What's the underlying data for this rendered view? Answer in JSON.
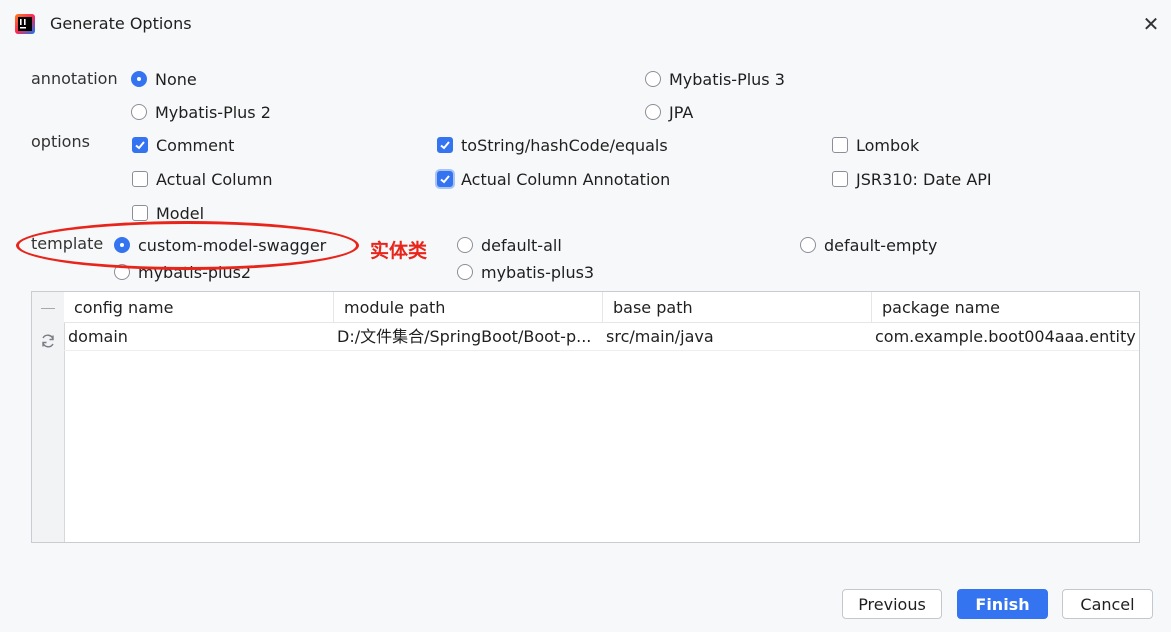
{
  "window": {
    "title": "Generate Options",
    "close_glyph": "✕"
  },
  "annotation": {
    "label": "annotation",
    "options": [
      {
        "label": "None",
        "selected": true
      },
      {
        "label": "Mybatis-Plus 3",
        "selected": false
      },
      {
        "label": "Mybatis-Plus 2",
        "selected": false
      },
      {
        "label": "JPA",
        "selected": false
      }
    ]
  },
  "options": {
    "label": "options",
    "items": [
      {
        "label": "Comment",
        "checked": true
      },
      {
        "label": "toString/hashCode/equals",
        "checked": true
      },
      {
        "label": "Lombok",
        "checked": false
      },
      {
        "label": "Actual Column",
        "checked": false
      },
      {
        "label": "Actual Column Annotation",
        "checked": true
      },
      {
        "label": "JSR310: Date API",
        "checked": false
      },
      {
        "label": "Model",
        "checked": false
      }
    ]
  },
  "template": {
    "label": "template",
    "options": [
      {
        "label": "custom-model-swagger",
        "selected": true
      },
      {
        "label": "default-all",
        "selected": false
      },
      {
        "label": "default-empty",
        "selected": false
      },
      {
        "label": "mybatis-plus2",
        "selected": false
      },
      {
        "label": "mybatis-plus3",
        "selected": false
      }
    ],
    "annotation_note": "实体类"
  },
  "table": {
    "columns": [
      "config name",
      "module path",
      "base path",
      "package name"
    ],
    "rows": [
      {
        "config_name": "domain",
        "module_path": "D:/文件集合/SpringBoot/Boot-p...",
        "base_path": "src/main/java",
        "package_name": "com.example.boot004aaa.entity"
      }
    ]
  },
  "buttons": {
    "previous": "Previous",
    "finish": "Finish",
    "cancel": "Cancel"
  },
  "colors": {
    "accent": "#3574f0",
    "annotation_red": "#e8251a"
  }
}
